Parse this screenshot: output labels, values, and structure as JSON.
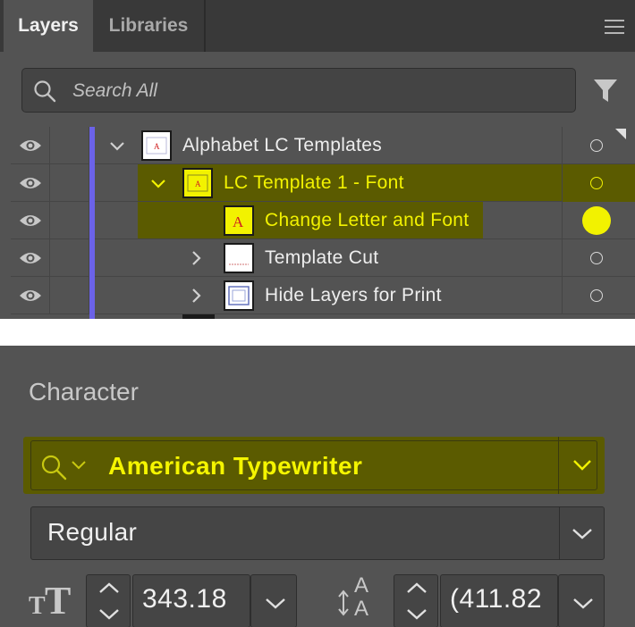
{
  "layers_panel": {
    "tabs": [
      {
        "label": "Layers",
        "active": true
      },
      {
        "label": "Libraries",
        "active": false
      }
    ],
    "search": {
      "placeholder": "Search All",
      "value": ""
    },
    "layers": [
      {
        "name": "Alphabet LC Templates",
        "visible": true,
        "expanded": true,
        "depth": 0,
        "highlighted": false,
        "selected": false
      },
      {
        "name": "LC Template 1 - Font",
        "visible": true,
        "expanded": true,
        "depth": 1,
        "highlighted": true,
        "selected": false
      },
      {
        "name": "Change Letter and Font",
        "visible": true,
        "expanded": false,
        "depth": 2,
        "highlighted": true,
        "selected": true
      },
      {
        "name": "Template Cut",
        "visible": true,
        "expanded": false,
        "depth": 2,
        "highlighted": false,
        "selected": false
      },
      {
        "name": "Hide Layers for Print",
        "visible": true,
        "expanded": false,
        "depth": 2,
        "highlighted": false,
        "selected": false
      }
    ],
    "layer_color": "#6b62e8",
    "highlight_color": "#f2f200"
  },
  "character_panel": {
    "title": "Character",
    "font_family": "American Typewriter",
    "font_style": "Regular",
    "font_size": "343.18",
    "leading": "(411.82"
  }
}
